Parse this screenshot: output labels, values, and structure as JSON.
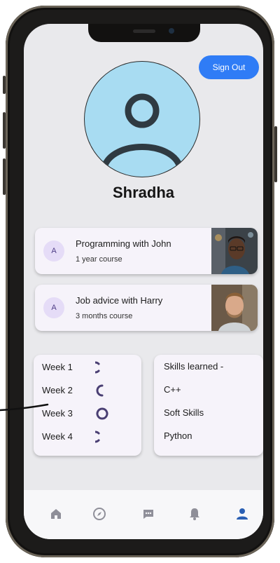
{
  "header": {
    "sign_out_label": "Sign Out"
  },
  "profile": {
    "name": "Shradha",
    "avatar_icon": "person-icon"
  },
  "courses": [
    {
      "avatar_letter": "A",
      "title": "Programming with John",
      "subtitle": "1 year course",
      "thumb_icon": "man-portrait-photo"
    },
    {
      "avatar_letter": "A",
      "title": "Job advice with Harry",
      "subtitle": "3 months course",
      "thumb_icon": "man-portrait-photo"
    }
  ],
  "progress": {
    "weeks": [
      {
        "label": "Week 1",
        "fraction": 0.75
      },
      {
        "label": "Week 2",
        "fraction": 0.5
      },
      {
        "label": "Week 3",
        "fraction": 1.0
      },
      {
        "label": "Week 4",
        "fraction": 0.75
      }
    ]
  },
  "skills": {
    "title": "Skills learned -",
    "items": [
      "C++",
      "Soft Skills",
      "Python"
    ]
  },
  "nav": {
    "items": [
      {
        "icon": "home-icon"
      },
      {
        "icon": "explore-icon"
      },
      {
        "icon": "chat-icon"
      },
      {
        "icon": "bell-icon"
      },
      {
        "icon": "profile-icon",
        "active": true
      }
    ]
  },
  "colors": {
    "accent": "#2f7cf6",
    "progress": "#4a3f73",
    "nav_inactive": "#8f8f99",
    "nav_active": "#2a5fb3",
    "avatar_bg": "#a8dcf2"
  }
}
